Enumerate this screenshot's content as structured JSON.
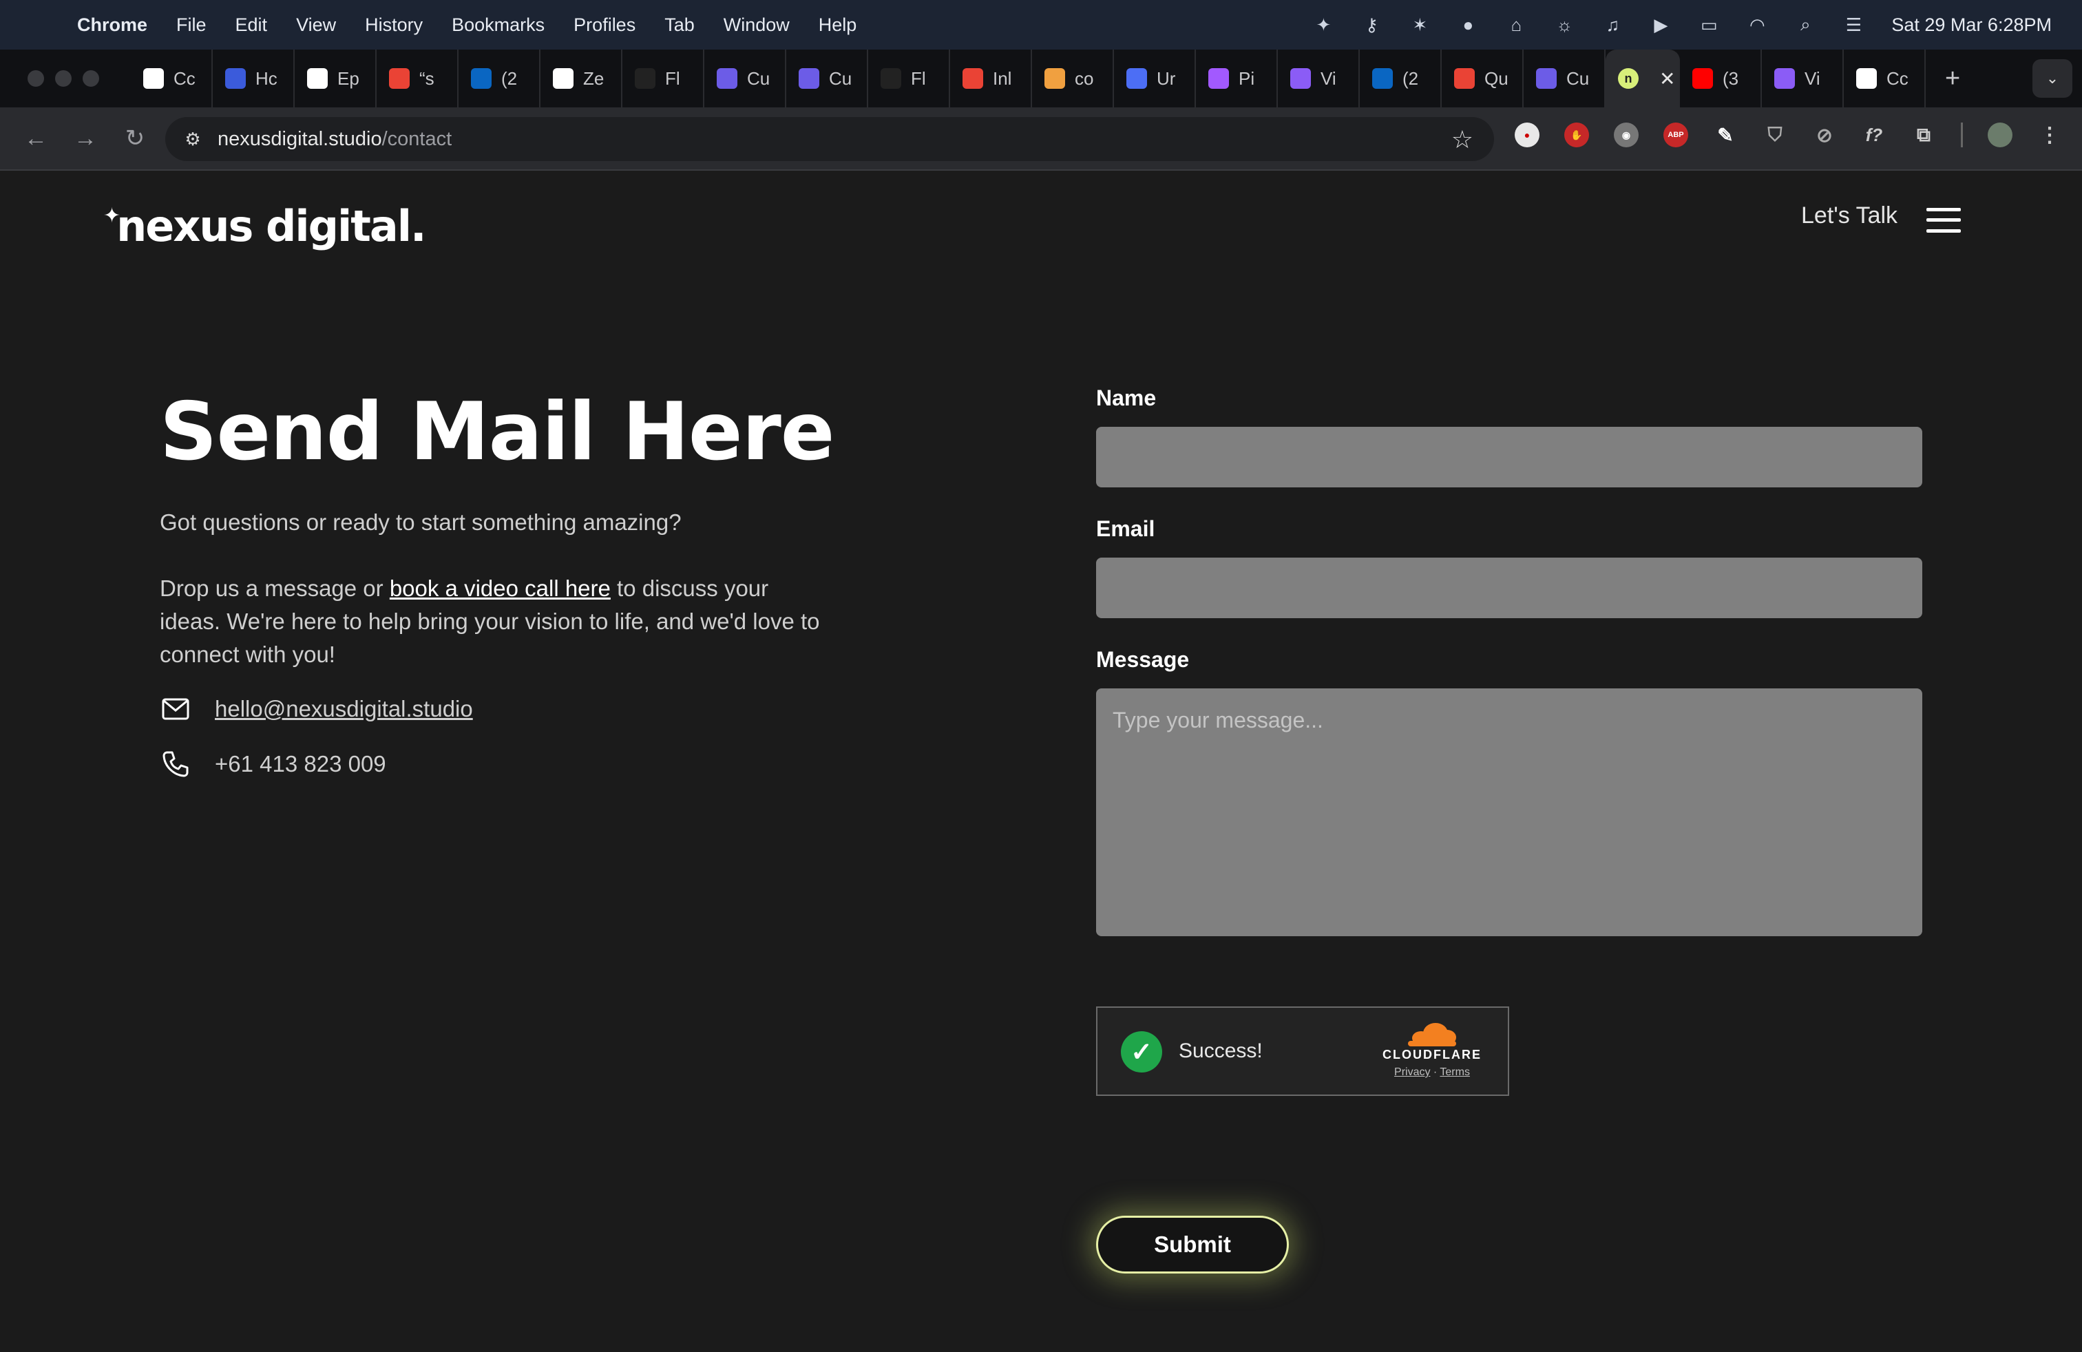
{
  "menubar": {
    "app_name": "Chrome",
    "items": [
      "File",
      "Edit",
      "View",
      "History",
      "Bookmarks",
      "Profiles",
      "Tab",
      "Window",
      "Help"
    ],
    "clock": "Sat 29 Mar  6:28PM"
  },
  "tabs": [
    {
      "label": "Cc",
      "color": "#ffffff"
    },
    {
      "label": "Hc",
      "color": "#3b5bdb"
    },
    {
      "label": "Ep",
      "color": "#ffffff"
    },
    {
      "label": "“s",
      "color": "#ea4335"
    },
    {
      "label": "(2",
      "color": "#0a66c2"
    },
    {
      "label": "Ze",
      "color": "#ffffff"
    },
    {
      "label": "Fl",
      "color": "#222222"
    },
    {
      "label": "Cu",
      "color": "#6c5ce7"
    },
    {
      "label": "Cu",
      "color": "#6c5ce7"
    },
    {
      "label": "Fl",
      "color": "#222222"
    },
    {
      "label": "Inl",
      "color": "#ea4335"
    },
    {
      "label": "co",
      "color": "#f0a040"
    },
    {
      "label": "Ur",
      "color": "#4c6ef5"
    },
    {
      "label": "Pi",
      "color": "#a259ff"
    },
    {
      "label": "Vi",
      "color": "#8b5cf6"
    },
    {
      "label": "(2",
      "color": "#0a66c2"
    },
    {
      "label": "Qu",
      "color": "#ea4335"
    },
    {
      "label": "Cu",
      "color": "#6c5ce7"
    }
  ],
  "active_tab": {
    "label": "n",
    "color": "#d8ef7a"
  },
  "tabs_after": [
    {
      "label": "(3",
      "color": "#ff0000"
    },
    {
      "label": "Vi",
      "color": "#8b5cf6"
    },
    {
      "label": "Cc",
      "color": "#ffffff"
    }
  ],
  "toolbar": {
    "url_domain": "nexusdigital.studio",
    "url_path": "/contact"
  },
  "site": {
    "logo": "nexus digital.",
    "nav_cta": "Let's Talk",
    "headline": "Send Mail Here",
    "intro": "Got questions or ready to start something amazing?",
    "body_before_link": "Drop us a message or ",
    "body_link": "book a video call here",
    "body_after_link": " to discuss your ideas. We're here to help bring your vision to life, and we'd love to connect with you!",
    "email": "hello@nexusdigital.studio",
    "phone": "+61 413 823 009"
  },
  "form": {
    "name_label": "Name",
    "name_value": "",
    "email_label": "Email",
    "email_value": "",
    "message_label": "Message",
    "message_placeholder": "Type your message...",
    "captcha_status": "Success!",
    "captcha_brand": "CLOUDFLARE",
    "captcha_privacy": "Privacy",
    "captcha_terms": "Terms",
    "submit_label": "Submit"
  },
  "colors": {
    "page_bg": "#1b1b1b",
    "input_bg": "#808080",
    "submit_glow": "#e6f0a6",
    "cloudflare_orange": "#f38020",
    "success_green": "#1fa64a"
  }
}
